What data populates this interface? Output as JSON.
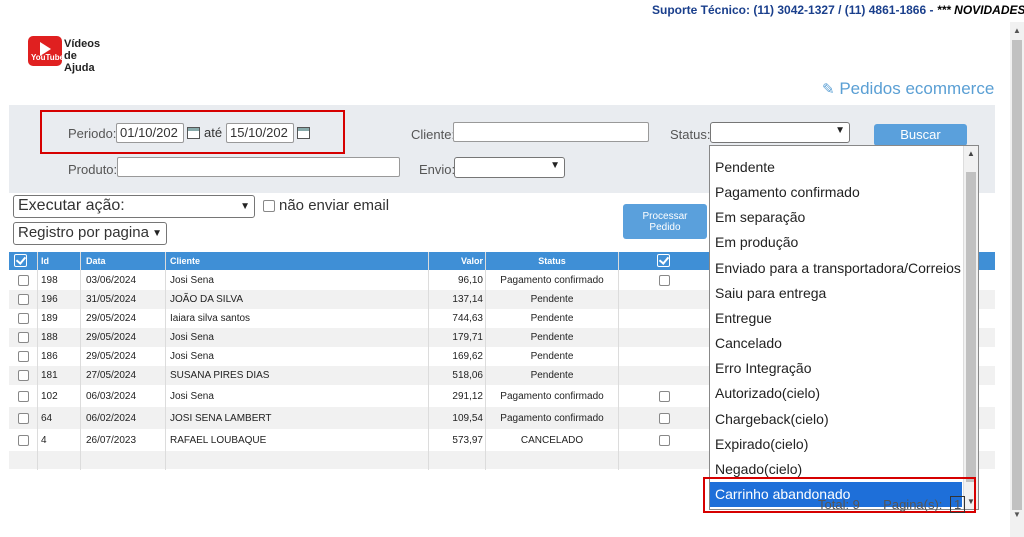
{
  "header": {
    "support_text": "Suporte Técnico: (11) 3042-1327 / (11) 4861-1866 - ",
    "news_text": "*** NOVIDADES ***",
    "video_logo_youtube": "YouTube",
    "video_logo_line1": "Vídeos",
    "video_logo_line2": "de Ajuda",
    "page_title": "Pedidos ecommerce",
    "title_icon": "edit-icon"
  },
  "filters": {
    "periodo_label": "Periodo:",
    "date_from": "01/10/202",
    "ate_label": "até",
    "date_to": "15/10/202",
    "cliente_label": "Cliente:",
    "cliente_value": "",
    "status_label": "Status:",
    "status_value": "",
    "buscar_label": "Buscar",
    "produto_label": "Produto:",
    "produto_value": "",
    "envio_label": "Envio:",
    "envio_value": ""
  },
  "actions": {
    "executar_acao": "Executar ação:",
    "nao_enviar_email": "não enviar email",
    "registro_por_pagina": "Registro por pagina",
    "processar_line1": "Processar",
    "processar_line2": "Pedido"
  },
  "table": {
    "headers": {
      "id": "Id",
      "data": "Data",
      "cliente": "Cliente",
      "valor": "Valor",
      "status": "Status"
    },
    "rows": [
      {
        "id": "198",
        "data": "03/06/2024",
        "cliente": "Josi Sena",
        "valor": "96,10",
        "status": "Pagamento confirmado"
      },
      {
        "id": "196",
        "data": "31/05/2024",
        "cliente": "JOÃO DA SILVA",
        "valor": "137,14",
        "status": "Pendente"
      },
      {
        "id": "189",
        "data": "29/05/2024",
        "cliente": "Iaiara silva santos",
        "valor": "744,63",
        "status": "Pendente"
      },
      {
        "id": "188",
        "data": "29/05/2024",
        "cliente": "Josi Sena",
        "valor": "179,71",
        "status": "Pendente"
      },
      {
        "id": "186",
        "data": "29/05/2024",
        "cliente": "Josi Sena",
        "valor": "169,62",
        "status": "Pendente"
      },
      {
        "id": "181",
        "data": "27/05/2024",
        "cliente": "SUSANA PIRES DIAS",
        "valor": "518,06",
        "status": "Pendente"
      },
      {
        "id": "102",
        "data": "06/03/2024",
        "cliente": "Josi Sena",
        "valor": "291,12",
        "status": "Pagamento confirmado"
      },
      {
        "id": "64",
        "data": "06/02/2024",
        "cliente": "JOSI SENA LAMBERT",
        "valor": "109,54",
        "status": "Pagamento confirmado"
      },
      {
        "id": "4",
        "data": "26/07/2023",
        "cliente": "RAFAEL LOUBAQUE",
        "valor": "573,97",
        "status": "CANCELADO"
      }
    ]
  },
  "status_dropdown": {
    "options": [
      "Pendente",
      "Pagamento confirmado",
      "Em separação",
      "Em produção",
      "Enviado para a transportadora/Correios",
      "Saiu para entrega",
      "Entregue",
      "Cancelado",
      "Erro Integração",
      "Autorizado(cielo)",
      "Chargeback(cielo)",
      "Expirado(cielo)",
      "Negado(cielo)",
      "Carrinho abandonado"
    ],
    "selected": "Carrinho abandonado"
  },
  "footer": {
    "total_label": "Total: 9",
    "pagina_label": "Pagina(s):",
    "page_value": "1"
  },
  "colors": {
    "accent": "#3f8fd6",
    "button": "#5aa0dc",
    "highlight": "#d60000",
    "selected_option": "#1e6fd9"
  }
}
